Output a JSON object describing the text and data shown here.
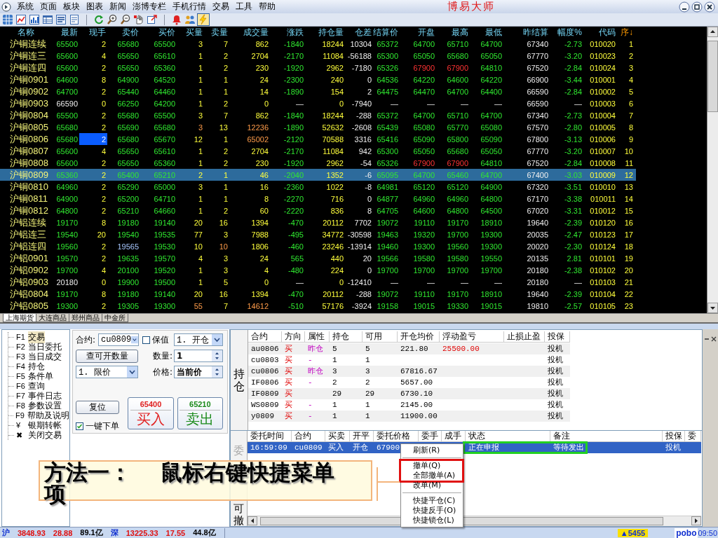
{
  "menu_bar": {
    "items": [
      "系统",
      "页面",
      "板块",
      "图表",
      "新闻",
      "澎博专栏",
      "手机行情",
      "交易",
      "工具",
      "帮助"
    ],
    "title": "博易大师"
  },
  "toolbar": {
    "buttons": [
      {
        "kind": "grid",
        "pressed": false
      },
      {
        "kind": "line-chart",
        "pressed": false
      },
      {
        "kind": "bar-chart",
        "pressed": false
      },
      {
        "kind": "table",
        "pressed": false
      },
      {
        "kind": "list",
        "pressed": false
      },
      {
        "kind": "document",
        "pressed": false
      },
      {
        "kind": "separator"
      },
      {
        "kind": "refresh",
        "pressed": false
      },
      {
        "kind": "zoom-in",
        "pressed": false
      },
      {
        "kind": "zoom-out",
        "pressed": false
      },
      {
        "kind": "hand",
        "pressed": false
      },
      {
        "kind": "export",
        "pressed": false
      },
      {
        "kind": "separator"
      },
      {
        "kind": "bell",
        "pressed": false
      },
      {
        "kind": "people",
        "pressed": false
      },
      {
        "kind": "lightning",
        "pressed": true
      }
    ]
  },
  "quote_table": {
    "columns": [
      {
        "label": "名称",
        "kind": "name",
        "sorted": false
      },
      {
        "label": "最新",
        "kind": "down",
        "sorted": false
      },
      {
        "label": "现手",
        "kind": "vol",
        "sorted": false
      },
      {
        "label": "卖价",
        "kind": "down",
        "sorted": false
      },
      {
        "label": "买价",
        "kind": "down",
        "sorted": false
      },
      {
        "label": "买量",
        "kind": "vol",
        "sorted": false
      },
      {
        "label": "卖量",
        "kind": "vol",
        "sorted": false
      },
      {
        "label": "成交量",
        "kind": "vol",
        "sorted": false
      },
      {
        "label": "涨跌",
        "kind": "down",
        "sorted": false
      },
      {
        "label": "持仓量",
        "kind": "vol",
        "sorted": false
      },
      {
        "label": "仓差",
        "kind": "flat",
        "sorted": false
      },
      {
        "label": "结算价",
        "kind": "down",
        "sorted": false
      },
      {
        "label": "开盘",
        "kind": "down",
        "sorted": false
      },
      {
        "label": "最高",
        "kind": "down",
        "sorted": false
      },
      {
        "label": "最低",
        "kind": "down",
        "sorted": false
      },
      {
        "label": "昨结算",
        "kind": "flat",
        "sorted": false
      },
      {
        "label": "幅度%",
        "kind": "down",
        "sorted": false
      },
      {
        "label": "代码",
        "kind": "vol",
        "sorted": false
      },
      {
        "label": "序↓",
        "kind": "vol",
        "sorted": true
      }
    ],
    "rows": [
      {
        "selected": false,
        "cells": [
          "沪铜连续",
          "65500",
          "2",
          "65680",
          "65500",
          "3",
          "7",
          "862",
          "-1840",
          "18244",
          "10304",
          "65372",
          "64700",
          "65710",
          "64700",
          "67340",
          "-2.73",
          "010020",
          "1"
        ]
      },
      {
        "selected": false,
        "cells": [
          "沪铜连三",
          "65600",
          "4",
          "65650",
          "65610",
          "1",
          "2",
          "2704",
          "-2170",
          "11084",
          "-56188",
          "65300",
          "65050",
          "65680",
          "65050",
          "67770",
          "-3.20",
          "010023",
          "2"
        ]
      },
      {
        "selected": false,
        "cells": [
          "沪铜连四",
          "65600",
          "2",
          "65650",
          "65360",
          "1",
          "2",
          "230",
          "-1920",
          "2962",
          "-7180",
          "65326",
          {
            "text": "67900",
            "kind": "up"
          },
          {
            "text": "67900",
            "kind": "up"
          },
          "64810",
          "67520",
          "-2.84",
          "010024",
          "3"
        ]
      },
      {
        "selected": false,
        "cells": [
          "沪铜0901",
          "64600",
          "8",
          "64900",
          "64520",
          "1",
          "1",
          "24",
          "-2300",
          "240",
          "0",
          "64536",
          "64220",
          "64600",
          "64220",
          "66900",
          "-3.44",
          "010001",
          "4"
        ]
      },
      {
        "selected": false,
        "cells": [
          "沪铜0902",
          "64700",
          "2",
          "65440",
          "64460",
          "1",
          "1",
          "14",
          "-1890",
          "154",
          "2",
          "64475",
          "64470",
          "64700",
          "64400",
          "66590",
          "-2.84",
          "010002",
          "5"
        ]
      },
      {
        "selected": false,
        "cells": [
          "沪铜0903",
          {
            "text": "66590",
            "kind": "flat"
          },
          "0",
          "66250",
          "64200",
          "1",
          "2",
          "0",
          {
            "text": "—",
            "kind": "flat"
          },
          "0",
          "-7940",
          {
            "text": "—",
            "kind": "flat"
          },
          {
            "text": "—",
            "kind": "flat"
          },
          {
            "text": "—",
            "kind": "flat"
          },
          {
            "text": "—",
            "kind": "flat"
          },
          "66590",
          {
            "text": "—",
            "kind": "flat"
          },
          "010003",
          "6"
        ]
      },
      {
        "selected": false,
        "cells": [
          "沪铜0804",
          "65500",
          "2",
          "65680",
          "65500",
          "3",
          "7",
          "862",
          "-1840",
          "18244",
          "-288",
          "65372",
          "64700",
          "65710",
          "64700",
          "67340",
          "-2.73",
          "010004",
          "7"
        ]
      },
      {
        "selected": false,
        "cells": [
          "沪铜0805",
          "65680",
          "2",
          "65690",
          "65680",
          {
            "text": "3",
            "kind": "hot"
          },
          "13",
          {
            "text": "12236",
            "kind": "hot"
          },
          "-1890",
          "52632",
          "-2608",
          "65439",
          "65080",
          "65770",
          "65080",
          "67570",
          "-2.80",
          "010005",
          "8"
        ]
      },
      {
        "selected": false,
        "cells": [
          "沪铜0806",
          "65680",
          {
            "text": "2",
            "kind": "cursor"
          },
          "65680",
          "65670",
          "12",
          "1",
          {
            "text": "65002",
            "kind": "hot"
          },
          "-2120",
          "70588",
          "3316",
          "65416",
          "65090",
          "65800",
          "65090",
          "67800",
          "-3.13",
          "010006",
          "9"
        ]
      },
      {
        "selected": false,
        "cells": [
          "沪铜0807",
          "65600",
          "4",
          "65650",
          "65610",
          "1",
          "2",
          "2704",
          "-2170",
          "11084",
          "942",
          "65300",
          "65050",
          "65680",
          "65050",
          "67770",
          "-3.20",
          "010007",
          "10"
        ]
      },
      {
        "selected": false,
        "cells": [
          "沪铜0808",
          "65600",
          "2",
          "65650",
          "65360",
          "1",
          "2",
          "230",
          "-1920",
          "2962",
          "-54",
          "65326",
          {
            "text": "67900",
            "kind": "up"
          },
          {
            "text": "67900",
            "kind": "up"
          },
          "64810",
          "67520",
          "-2.84",
          "010008",
          "11"
        ]
      },
      {
        "selected": true,
        "cells": [
          "沪铜0809",
          "65360",
          "2",
          "65400",
          "65210",
          "2",
          "1",
          "46",
          "-2040",
          "1352",
          "-6",
          "65095",
          "64700",
          "65460",
          "64700",
          "67400",
          "-3.03",
          "010009",
          "12"
        ]
      },
      {
        "selected": false,
        "cells": [
          "沪铜0810",
          "64960",
          "2",
          "65290",
          "65000",
          "3",
          "1",
          "16",
          "-2360",
          "1022",
          "-8",
          "64981",
          "65120",
          "65120",
          "64900",
          "67320",
          "-3.51",
          "010010",
          "13"
        ]
      },
      {
        "selected": false,
        "cells": [
          "沪铜0811",
          "64900",
          "2",
          "65200",
          "64710",
          "1",
          "1",
          "8",
          "-2270",
          "716",
          "0",
          "64877",
          "64960",
          "64960",
          "64800",
          "67170",
          "-3.38",
          "010011",
          "14"
        ]
      },
      {
        "selected": false,
        "cells": [
          "沪铜0812",
          "64800",
          "2",
          "65210",
          "64660",
          "1",
          "2",
          "60",
          "-2220",
          "836",
          "8",
          "64705",
          "64600",
          "64800",
          "64500",
          "67020",
          "-3.31",
          "010012",
          "15"
        ]
      },
      {
        "selected": false,
        "cells": [
          "沪铝连续",
          "19170",
          "8",
          "19180",
          "19140",
          "20",
          "16",
          "1394",
          "-470",
          "20112",
          "7702",
          "19072",
          "19110",
          "19170",
          "18910",
          "19640",
          "-2.39",
          "010120",
          "16"
        ]
      },
      {
        "selected": false,
        "cells": [
          "沪铝连三",
          "19540",
          "20",
          "19540",
          "19535",
          "77",
          "3",
          "7988",
          "-495",
          "34772",
          "-30598",
          "19463",
          "19320",
          "19700",
          "19300",
          "20035",
          "-2.47",
          "010123",
          "17"
        ]
      },
      {
        "selected": false,
        "cells": [
          "沪铝连四",
          "19560",
          "2",
          {
            "text": "19565",
            "kind": "ask"
          },
          "19530",
          "10",
          {
            "text": "10",
            "kind": "hot"
          },
          "1806",
          "-460",
          "23246",
          "-13914",
          "19460",
          "19300",
          "19560",
          "19300",
          "20020",
          "-2.30",
          "010124",
          "18"
        ]
      },
      {
        "selected": false,
        "cells": [
          "沪铝0901",
          "19570",
          "2",
          "19635",
          "19570",
          "4",
          "3",
          "24",
          "565",
          "440",
          "20",
          "19566",
          "19580",
          "19580",
          "19550",
          "20135",
          "2.81",
          "010101",
          "19"
        ]
      },
      {
        "selected": false,
        "cells": [
          "沪铝0902",
          "19700",
          "4",
          "20100",
          "19520",
          "1",
          "3",
          "4",
          "-480",
          "224",
          "0",
          "19700",
          "19700",
          "19700",
          "19700",
          "20180",
          "-2.38",
          "010102",
          "20"
        ]
      },
      {
        "selected": false,
        "cells": [
          "沪铝0903",
          {
            "text": "20180",
            "kind": "flat"
          },
          "0",
          "19900",
          "19500",
          "1",
          "5",
          "0",
          {
            "text": "—",
            "kind": "flat"
          },
          "0",
          "-12410",
          {
            "text": "—",
            "kind": "flat"
          },
          {
            "text": "—",
            "kind": "flat"
          },
          {
            "text": "—",
            "kind": "flat"
          },
          {
            "text": "—",
            "kind": "flat"
          },
          "20180",
          {
            "text": "—",
            "kind": "flat"
          },
          "010103",
          "21"
        ]
      },
      {
        "selected": false,
        "cells": [
          "沪铝0804",
          "19170",
          "8",
          "19180",
          "19140",
          "20",
          "16",
          "1394",
          "-470",
          "20112",
          "-288",
          "19072",
          "19110",
          "19170",
          "18910",
          "19640",
          "-2.39",
          "010104",
          "22"
        ]
      },
      {
        "selected": false,
        "cells": [
          "沪铝0805",
          "19300",
          "2",
          "19305",
          "19300",
          {
            "text": "55",
            "kind": "hot"
          },
          "7",
          {
            "text": "14612",
            "kind": "hot"
          },
          "-510",
          "57176",
          "-3924",
          "19158",
          "19015",
          "19330",
          "19015",
          "19810",
          "-2.57",
          "010105",
          "23"
        ]
      }
    ]
  },
  "market_tabs": [
    {
      "label": "上海期货",
      "selected": true
    },
    {
      "label": "大连商品",
      "selected": false
    },
    {
      "label": "郑州商品",
      "selected": false
    },
    {
      "label": "中金所",
      "selected": false
    }
  ],
  "trade_menu": {
    "items": [
      {
        "key": "F1",
        "label": "交易",
        "selected": true
      },
      {
        "key": "F2",
        "label": "当日委托",
        "selected": false
      },
      {
        "key": "F3",
        "label": "当日成交",
        "selected": false
      },
      {
        "key": "F4",
        "label": "持仓",
        "selected": false
      },
      {
        "key": "F5",
        "label": "条件单",
        "selected": false
      },
      {
        "key": "F6",
        "label": "查询",
        "selected": false
      },
      {
        "key": "F7",
        "label": "事件日志",
        "selected": false
      },
      {
        "key": "F8",
        "label": "参数设置",
        "selected": false
      },
      {
        "key": "F9",
        "label": "帮助及说明",
        "selected": false
      },
      {
        "key": "¥",
        "label": "银期转帐",
        "selected": false
      },
      {
        "key": "✖",
        "label": "关闭交易",
        "selected": false
      }
    ]
  },
  "order_form": {
    "contract_label": "合约:",
    "contract": "cu0809",
    "hedge": {
      "label": "保值",
      "checked": false
    },
    "offset": "1. 开仓",
    "query_button": "查可开数量",
    "quantity_label": "数量:",
    "quantity": "1",
    "price_type": "1. 限价",
    "price_label": "价格:",
    "price": "当前价",
    "reset_button": "复位",
    "one_click": {
      "label": "一键下单",
      "checked": true
    },
    "buy": {
      "price": "65400",
      "label": "买入"
    },
    "sell": {
      "price": "65210",
      "label": "卖出"
    }
  },
  "positions": {
    "side_label": "持仓",
    "columns": [
      "合约",
      "方向",
      "属性",
      "持仓",
      "可用",
      "开仓均价",
      "浮动盈亏",
      "止损止盈",
      "投保"
    ],
    "rows": [
      {
        "contract": "au0806",
        "side": "买",
        "attr": "昨仓",
        "qty": "5",
        "avail": "5",
        "avg_price": "221.80",
        "pnl": "25500.00",
        "hedge": "投机"
      },
      {
        "contract": "cu0803",
        "side": "买",
        "attr": "-",
        "qty": "1",
        "avail": "1",
        "hedge": "投机"
      },
      {
        "contract": "cu0806",
        "side": "买",
        "attr": "昨仓",
        "qty": "3",
        "avail": "3",
        "avg_price": "67816.67",
        "hedge": "投机"
      },
      {
        "contract": "IF0806",
        "side": "买",
        "attr": "-",
        "qty": "2",
        "avail": "2",
        "avg_price": "5657.00",
        "hedge": "投机"
      },
      {
        "contract": "IF0809",
        "side": "买",
        "qty": "29",
        "avail": "29",
        "avg_price": "6730.10",
        "hedge": "投机"
      },
      {
        "contract": "WS0809",
        "side": "买",
        "attr": "-",
        "qty": "1",
        "avail": "1",
        "avg_price": "2145.00",
        "hedge": "投机"
      },
      {
        "contract": "y0809",
        "side": "买",
        "attr": "-",
        "qty": "1",
        "avail": "1",
        "avg_price": "11900.00",
        "hedge": "投机"
      }
    ]
  },
  "orders": {
    "side_label_top": "委",
    "side_label_bottom": "可撤",
    "columns": [
      "委托时间",
      "合约",
      "买卖",
      "开平",
      "委托价格",
      "委手",
      "成手",
      "状态",
      "备注",
      "投保",
      "委"
    ],
    "rows": [
      {
        "time": "16:59:09",
        "contract": "cu0809",
        "side": "买入",
        "offset": "开仓",
        "price": "67900",
        "status": "正在申报",
        "note": "等待发出",
        "hedge": "投机",
        "selected": true,
        "highlighted": true
      }
    ]
  },
  "context_menu": {
    "items": [
      {
        "kind": "item",
        "label": "刷新(R)",
        "framed": false
      },
      {
        "kind": "separator"
      },
      {
        "kind": "item",
        "label": "撤单(Q)",
        "framed": true
      },
      {
        "kind": "item",
        "label": "全部撤单(A)",
        "framed": true
      },
      {
        "kind": "item",
        "label": "改单(M)",
        "framed": false
      },
      {
        "kind": "separator"
      },
      {
        "kind": "item",
        "label": "快捷平仓(C)",
        "framed": false
      },
      {
        "kind": "item",
        "label": "快捷反手(O)",
        "framed": false
      },
      {
        "kind": "item",
        "label": "快捷锁仓(L)",
        "framed": false
      }
    ]
  },
  "callout": {
    "text": "方法一：　 鼠标右键快捷菜单项"
  },
  "status_bar": {
    "quotes": [
      {
        "text": "沪",
        "kind": "market"
      },
      {
        "text": "3848.93",
        "kind": "up"
      },
      {
        "text": "28.88",
        "kind": "up"
      },
      {
        "text": "89.1亿",
        "kind": "amount"
      },
      {
        "text": "深",
        "kind": "market"
      },
      {
        "text": "13225.33",
        "kind": "up"
      },
      {
        "text": "17.55",
        "kind": "up"
      },
      {
        "text": "44.8亿",
        "kind": "amount"
      }
    ],
    "alert": "▲5455",
    "brand": "pobo",
    "time": "09:50"
  }
}
